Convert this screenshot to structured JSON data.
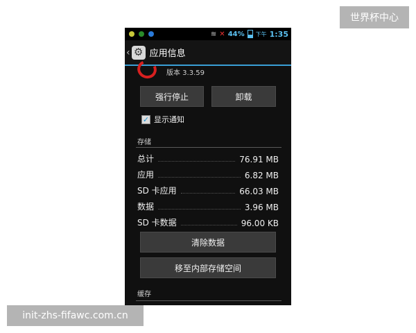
{
  "watermarks": {
    "top_right": "世界杯中心",
    "bottom_left": "init-zhs-fifawc.com.cn"
  },
  "status_bar": {
    "battery": "44%",
    "ampm": "下午",
    "time": "1:35"
  },
  "action_bar": {
    "title": "应用信息"
  },
  "app": {
    "version": "版本 3.3.59"
  },
  "buttons": {
    "force_stop": "强行停止",
    "uninstall": "卸载",
    "clear_data": "清除数据",
    "move": "移至内部存储空间"
  },
  "notifications": {
    "label": "显示通知",
    "checked": true
  },
  "storage": {
    "title": "存储",
    "rows": [
      {
        "label": "总计",
        "value": "76.91 MB"
      },
      {
        "label": "应用",
        "value": "6.82 MB"
      },
      {
        "label": "SD 卡应用",
        "value": "66.03 MB"
      },
      {
        "label": "数据",
        "value": "3.96 MB"
      },
      {
        "label": "SD 卡数据",
        "value": "96.00 KB"
      }
    ]
  },
  "cache": {
    "title": "缓存"
  },
  "colors": {
    "accent": "#3a9fd6",
    "background": "#101010",
    "button": "#3a3a3a"
  }
}
